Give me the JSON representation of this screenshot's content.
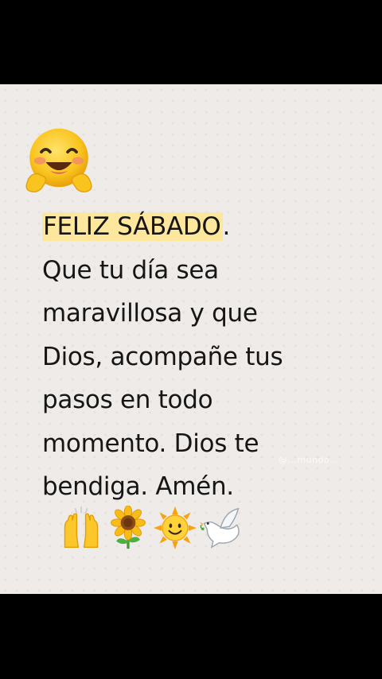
{
  "card": {
    "background_color": "#efebe8",
    "highlight_color": "#fde79c",
    "text_color": "#161616"
  },
  "message": {
    "headline": "FELIZ SÁBADO",
    "headline_punct": ".",
    "lines": [
      "Que tu día sea",
      "maravillosa y que",
      "Dios, acompañe tus",
      "pasos en todo",
      "momento. Dios te",
      "bendiga. Amén."
    ]
  },
  "icons": {
    "top": "hugging-face-icon",
    "row": [
      "raising-hands-icon",
      "sunflower-icon",
      "sun-with-face-icon",
      "dove-icon"
    ]
  },
  "watermark": {
    "text": "@...mundo..."
  }
}
